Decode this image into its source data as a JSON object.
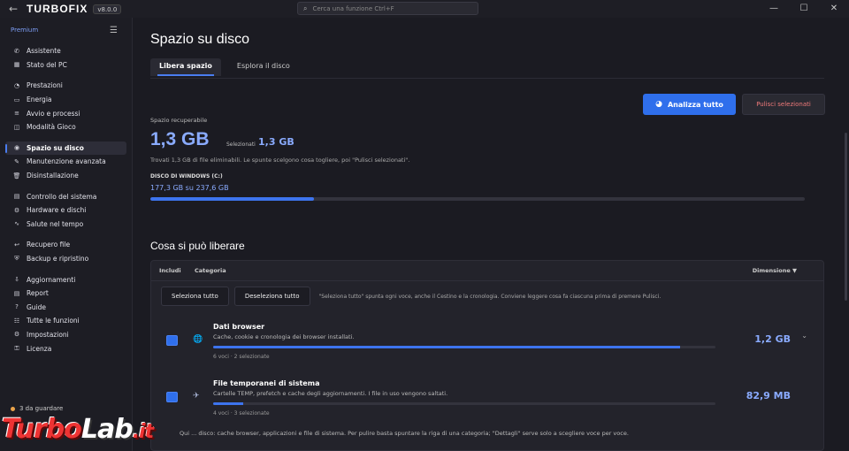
{
  "app": {
    "logo": "TURBOFIX",
    "version": "v8.0.0"
  },
  "titlebar": {
    "back_icon": "←",
    "search_placeholder": "Cerca una funzione   Ctrl+F",
    "controls": [
      "—",
      "☐",
      "✕"
    ]
  },
  "sidebar": {
    "premium": "Premium",
    "menu_icon": "☰",
    "groups": [
      [
        {
          "label": "Assistente",
          "icon": "✆"
        },
        {
          "label": "Stato del PC",
          "icon": "▦"
        }
      ],
      [
        {
          "label": "Prestazioni",
          "icon": "◔"
        },
        {
          "label": "Energia",
          "icon": "▭"
        },
        {
          "label": "Avvio e processi",
          "icon": "≡"
        },
        {
          "label": "Modalità Gioco",
          "icon": "◫"
        }
      ],
      [
        {
          "label": "Spazio su disco",
          "icon": "◉",
          "active": true
        },
        {
          "label": "Manutenzione avanzata",
          "icon": "✎"
        },
        {
          "label": "Disinstallazione",
          "icon": "🗑"
        }
      ],
      [
        {
          "label": "Controllo del sistema",
          "icon": "▤"
        },
        {
          "label": "Hardware e dischi",
          "icon": "⚙"
        },
        {
          "label": "Salute nel tempo",
          "icon": "∿"
        }
      ],
      [
        {
          "label": "Recupero file",
          "icon": "↩"
        },
        {
          "label": "Backup e ripristino",
          "icon": "⛨"
        }
      ],
      [
        {
          "label": "Aggiornamenti",
          "icon": "⇩"
        },
        {
          "label": "Report",
          "icon": "▤"
        },
        {
          "label": "Guide",
          "icon": "?"
        },
        {
          "label": "Tutte le funzioni",
          "icon": "☷"
        },
        {
          "label": "Impostazioni",
          "icon": "⚙"
        },
        {
          "label": "Licenza",
          "icon": "⚿"
        }
      ]
    ],
    "footer": "3 da guardare"
  },
  "main": {
    "title": "Spazio su disco",
    "tabs": [
      "Libera spazio",
      "Esplora il disco"
    ],
    "analyze_button": "Analizza tutto",
    "clean_button": "Pulisci selezionati",
    "recoverable_label": "Spazio recuperabile",
    "recoverable_value": "1,3 GB",
    "selected_label": "Selezionati",
    "selected_value": "1,3 GB",
    "description": "Trovati 1,3 GB di file eliminabili. Le spunte scelgono cosa togliere, poi \"Pulisci selezionati\".",
    "disk_label": "DISCO DI WINDOWS (C:)",
    "disk_value": "177,3 GB su 237,6 GB",
    "disk_used_fraction": 0.25,
    "section_title": "Cosa si può liberare",
    "table": {
      "col_include": "Includi",
      "col_category": "Categoria",
      "col_size": "Dimensione ▼",
      "select_all": "Seleziona tutto",
      "deselect_all": "Deseleziona tutto",
      "hint": "\"Seleziona tutto\" spunta ogni voce, anche il Cestino e la cronologia. Conviene leggere cosa fa ciascuna prima di premere Pulisci.",
      "rows": [
        {
          "title": "Dati browser",
          "description": "Cache, cookie e cronologia dei browser installati.",
          "meta": "6 voci · 2 selezionate",
          "size": "1,2 GB",
          "icon": "🌐",
          "fill": 0.93,
          "chevron": "⌄"
        },
        {
          "title": "File temporanei di sistema",
          "description": "Cartelle TEMP, prefetch e cache degli aggiornamenti. I file in uso vengono saltati.",
          "meta": "4 voci · 3 selezionate",
          "size": "82,9 MB",
          "icon": "✈",
          "fill": 0.06,
          "chevron": ""
        }
      ]
    },
    "footnote": "Qui ... disco: cache browser, applicazioni e file di sistema. Per pulire basta spuntare la riga di una categoria; \"Dettagli\" serve solo a scegliere voce per voce."
  },
  "watermark": {
    "part1": "Turbo",
    "part2": "Lab",
    "part3": ".it"
  }
}
